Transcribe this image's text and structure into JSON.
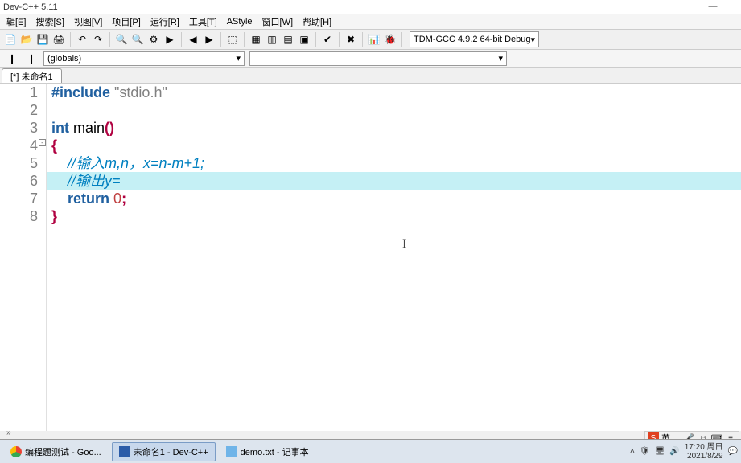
{
  "window": {
    "title": "Dev-C++ 5.11"
  },
  "menus": [
    "辑[E]",
    "搜索[S]",
    "视图[V]",
    "项目[P]",
    "运行[R]",
    "工具[T]",
    "AStyle",
    "窗口[W]",
    "帮助[H]"
  ],
  "compiler_selector": "TDM-GCC 4.9.2 64-bit Debug",
  "globals_selector": "(globals)",
  "tab": {
    "label": "[*] 未命名1"
  },
  "code": {
    "lines": [
      {
        "n": 1,
        "seg": [
          [
            "kw",
            "#include "
          ],
          [
            "str",
            "\"stdio.h\""
          ]
        ]
      },
      {
        "n": 2,
        "seg": []
      },
      {
        "n": 3,
        "seg": [
          [
            "kw",
            "int"
          ],
          [
            "",
            " main"
          ],
          [
            "punc",
            "()"
          ]
        ]
      },
      {
        "n": 4,
        "seg": [
          [
            "punc",
            "{"
          ]
        ],
        "fold": true
      },
      {
        "n": 5,
        "seg": [
          [
            "",
            "    "
          ],
          [
            "cmt",
            "//输入m,n，x=n-m+1;"
          ]
        ]
      },
      {
        "n": 6,
        "seg": [
          [
            "",
            "    "
          ],
          [
            "cmt",
            "//输出y="
          ]
        ],
        "hl": true,
        "cursor": true
      },
      {
        "n": 7,
        "seg": [
          [
            "",
            "    "
          ],
          [
            "kw",
            "return"
          ],
          [
            "",
            " "
          ],
          [
            "num",
            "0"
          ],
          [
            "punc",
            ";"
          ]
        ]
      },
      {
        "n": 8,
        "seg": [
          [
            "punc",
            "}"
          ]
        ]
      }
    ]
  },
  "taskbar": {
    "items": [
      {
        "label": "编程题测试 - Goo...",
        "browser": true
      },
      {
        "label": "未命名1 - Dev-C++",
        "active": true
      },
      {
        "label": "demo.txt - 记事本"
      }
    ],
    "clock_time": "17:20 周日",
    "clock_date": "2021/8/29"
  },
  "ime": {
    "label": "英",
    "punct": "，"
  },
  "icons": {
    "new": "📄",
    "open": "📂",
    "save": "💾",
    "print": "🖨",
    "undo": "↶",
    "redo": "↷",
    "find": "🔍",
    "compile": "⚙",
    "run": "▶",
    "grid1": "▦",
    "grid2": "▥",
    "grid3": "▤",
    "grid4": "▣",
    "check": "✔",
    "close": "✖",
    "chart": "📊",
    "debug": "🐞",
    "a": "❙",
    "b": "❙",
    "c": "⬚",
    "left": "◀",
    "right": "▶"
  }
}
